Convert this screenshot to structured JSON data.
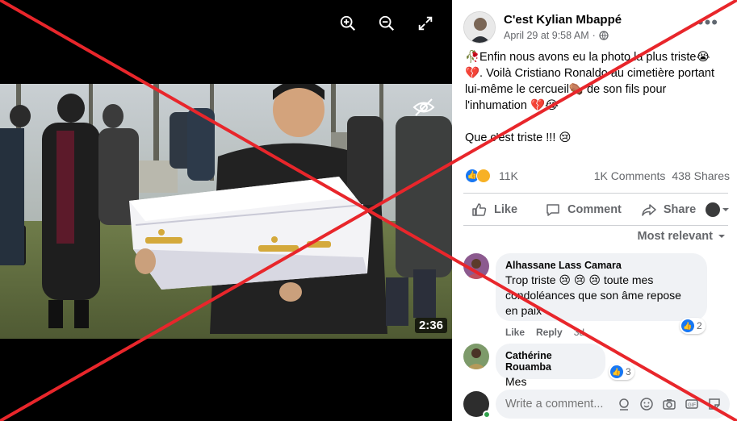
{
  "media": {
    "duration": "2:36",
    "toolbar": [
      "zoom-in-icon",
      "zoom-out-icon",
      "fullscreen-icon"
    ]
  },
  "post": {
    "author": "C'est Kylian Mbappé",
    "date": "April 29 at 9:58 AM",
    "separator": "·",
    "audience_icon": "globe-icon",
    "text_line1": "🥀Enfin nous avons eu la photo la plus triste😭",
    "text_line2": "💔. Voilà Cristiano Ronaldo au cimetière portant",
    "text_line3": "lui-même le cercueil⚰️ de son fils pour",
    "text_line4": "l'inhumation 💔😭",
    "text_line5": "Que c'est triste !!! 😢",
    "reactions_count": "11K",
    "comments_count": "1K Comments",
    "shares_count": "438 Shares"
  },
  "actions": {
    "like": "Like",
    "comment": "Comment",
    "share": "Share"
  },
  "sort": {
    "label": "Most relevant"
  },
  "comments": [
    {
      "name": "Alhassane Lass Camara",
      "line1": "Trop triste 😢 😢 😢 toute mes",
      "line2": "condoléances que son âme repose",
      "line3": "en paix",
      "like": "Like",
      "reply": "Reply",
      "time": "3d",
      "reactions": "2"
    },
    {
      "name": "Cathérine Rouamba",
      "line1": "Mes condoléances",
      "reactions": "3"
    }
  ],
  "composer": {
    "placeholder": "Write a comment..."
  },
  "colors": {
    "cross": "#e8262b",
    "accent": "#1877f2",
    "secondary_text": "#65676b"
  }
}
